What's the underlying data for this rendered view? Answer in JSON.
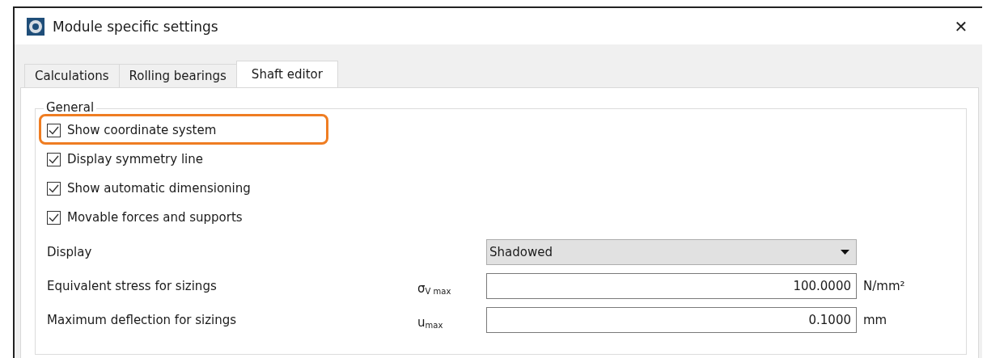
{
  "window": {
    "title": "Module specific settings",
    "close": "✕"
  },
  "tabs": [
    {
      "label": "Calculations",
      "selected": false
    },
    {
      "label": "Rolling bearings",
      "selected": false
    },
    {
      "label": "Shaft editor",
      "selected": true
    }
  ],
  "group": {
    "title": "General",
    "checkboxes": [
      {
        "label": "Show coordinate system",
        "checked": true,
        "highlighted": true
      },
      {
        "label": "Display symmetry line",
        "checked": true,
        "highlighted": false
      },
      {
        "label": "Show automatic dimensioning",
        "checked": true,
        "highlighted": false
      },
      {
        "label": "Movable forces and supports",
        "checked": true,
        "highlighted": false
      }
    ],
    "fields": [
      {
        "kind": "dropdown",
        "label": "Display",
        "value": "Shadowed"
      },
      {
        "kind": "number",
        "label": "Equivalent stress for sizings",
        "symbol": "σ$_{V max}$",
        "value": "100.0000",
        "unit": "N/mm²"
      },
      {
        "kind": "number",
        "label": "Maximum deflection for sizings",
        "symbol": "u$_{max}$",
        "value": "0.1000",
        "unit": "mm"
      }
    ]
  }
}
